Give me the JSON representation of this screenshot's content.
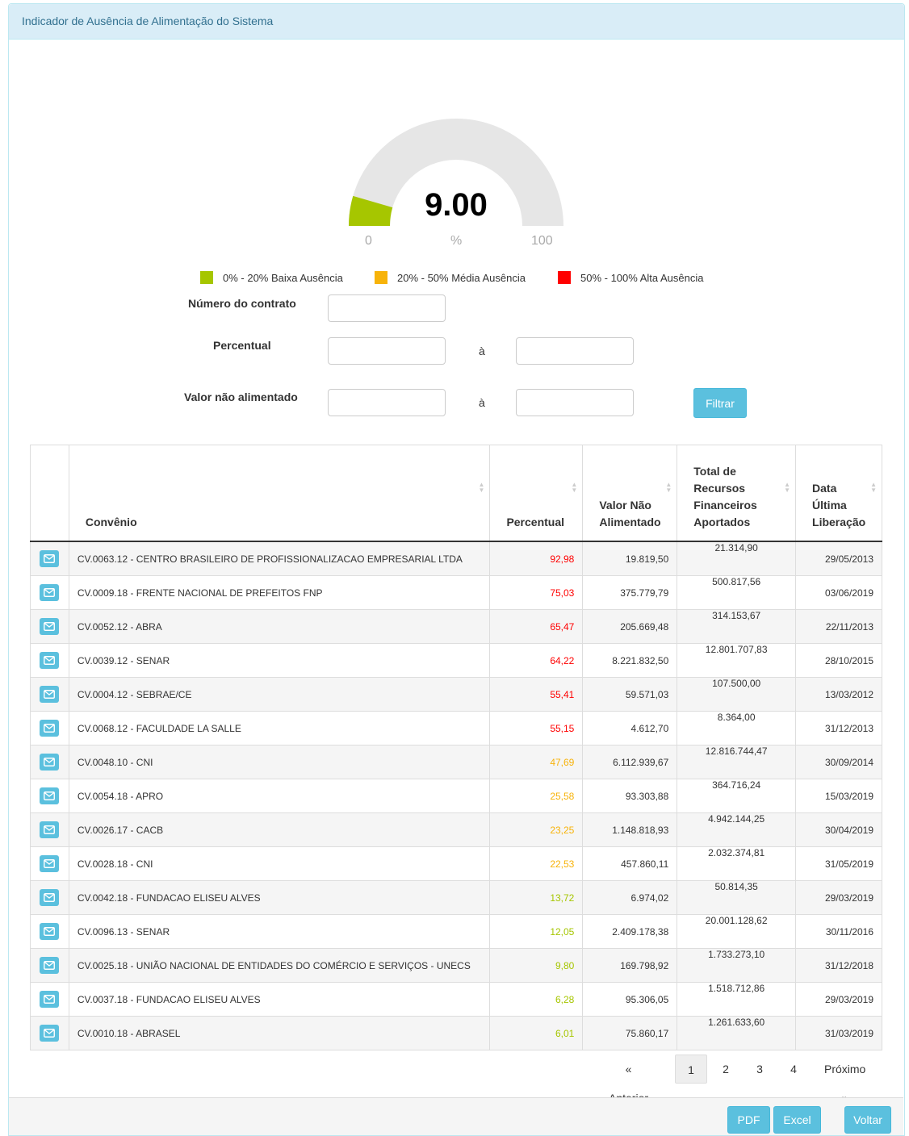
{
  "panel": {
    "title": "Indicador de Ausência de Alimentação do Sistema"
  },
  "gauge": {
    "value": "9.00",
    "level": 9,
    "min_label": "0",
    "unit_label": "%",
    "max_label": "100",
    "fill_color": "#a6c600"
  },
  "legend": [
    {
      "label": "0% - 20% Baixa Ausência",
      "color": "#a6c600"
    },
    {
      "label": "20% - 50% Média Ausência",
      "color": "#f7b30a"
    },
    {
      "label": "50% - 100% Alta Ausência",
      "color": "#ff0000"
    }
  ],
  "filters": {
    "contract_label": "Número do contrato",
    "percent_label": "Percentual",
    "value_label": "Valor não alimentado",
    "range_sep": "à",
    "filter_button": "Filtrar"
  },
  "table": {
    "headers": [
      "Convênio",
      "Percentual",
      "Valor Não Alimentado",
      "Total de Recursos Financeiros Aportados",
      "Data Última Liberação"
    ],
    "rows": [
      {
        "convenio": "CV.0063.12 - CENTRO BRASILEIRO DE PROFISSIONALIZACAO EMPRESARIAL LTDA",
        "percentual": "92,98",
        "pct_color": "#ff0000",
        "valor": "19.819,50",
        "total": "21.314,90",
        "data": "29/05/2013"
      },
      {
        "convenio": "CV.0009.18 - FRENTE NACIONAL DE PREFEITOS FNP",
        "percentual": "75,03",
        "pct_color": "#ff0000",
        "valor": "375.779,79",
        "total": "500.817,56",
        "data": "03/06/2019"
      },
      {
        "convenio": "CV.0052.12 - ABRA",
        "percentual": "65,47",
        "pct_color": "#ff0000",
        "valor": "205.669,48",
        "total": "314.153,67",
        "data": "22/11/2013"
      },
      {
        "convenio": "CV.0039.12 - SENAR",
        "percentual": "64,22",
        "pct_color": "#ff0000",
        "valor": "8.221.832,50",
        "total": "12.801.707,83",
        "data": "28/10/2015"
      },
      {
        "convenio": "CV.0004.12 - SEBRAE/CE",
        "percentual": "55,41",
        "pct_color": "#ff0000",
        "valor": "59.571,03",
        "total": "107.500,00",
        "data": "13/03/2012"
      },
      {
        "convenio": "CV.0068.12 - FACULDADE LA SALLE",
        "percentual": "55,15",
        "pct_color": "#ff0000",
        "valor": "4.612,70",
        "total": "8.364,00",
        "data": "31/12/2013"
      },
      {
        "convenio": "CV.0048.10 - CNI",
        "percentual": "47,69",
        "pct_color": "#f7b30a",
        "valor": "6.112.939,67",
        "total": "12.816.744,47",
        "data": "30/09/2014"
      },
      {
        "convenio": "CV.0054.18 - APRO",
        "percentual": "25,58",
        "pct_color": "#f7b30a",
        "valor": "93.303,88",
        "total": "364.716,24",
        "data": "15/03/2019"
      },
      {
        "convenio": "CV.0026.17 - CACB",
        "percentual": "23,25",
        "pct_color": "#f7b30a",
        "valor": "1.148.818,93",
        "total": "4.942.144,25",
        "data": "30/04/2019"
      },
      {
        "convenio": "CV.0028.18 - CNI",
        "percentual": "22,53",
        "pct_color": "#f7b30a",
        "valor": "457.860,11",
        "total": "2.032.374,81",
        "data": "31/05/2019"
      },
      {
        "convenio": "CV.0042.18 - FUNDACAO ELISEU ALVES",
        "percentual": "13,72",
        "pct_color": "#a6c600",
        "valor": "6.974,02",
        "total": "50.814,35",
        "data": "29/03/2019"
      },
      {
        "convenio": "CV.0096.13 - SENAR",
        "percentual": "12,05",
        "pct_color": "#a6c600",
        "valor": "2.409.178,38",
        "total": "20.001.128,62",
        "data": "30/11/2016"
      },
      {
        "convenio": "CV.0025.18 - UNIÃO NACIONAL DE ENTIDADES DO COMÉRCIO E SERVIÇOS - UNECS",
        "percentual": "9,80",
        "pct_color": "#a6c600",
        "valor": "169.798,92",
        "total": "1.733.273,10",
        "data": "31/12/2018"
      },
      {
        "convenio": "CV.0037.18 - FUNDACAO ELISEU ALVES",
        "percentual": "6,28",
        "pct_color": "#a6c600",
        "valor": "95.306,05",
        "total": "1.518.712,86",
        "data": "29/03/2019"
      },
      {
        "convenio": "CV.0010.18 - ABRASEL",
        "percentual": "6,01",
        "pct_color": "#a6c600",
        "valor": "75.860,17",
        "total": "1.261.633,60",
        "data": "31/03/2019"
      }
    ]
  },
  "pagination": {
    "prev": "« Anterior",
    "pages": [
      "1",
      "2",
      "3",
      "4"
    ],
    "active": "1",
    "next": "Próximo »"
  },
  "footer": {
    "pdf": "PDF",
    "excel": "Excel",
    "back": "Voltar"
  }
}
